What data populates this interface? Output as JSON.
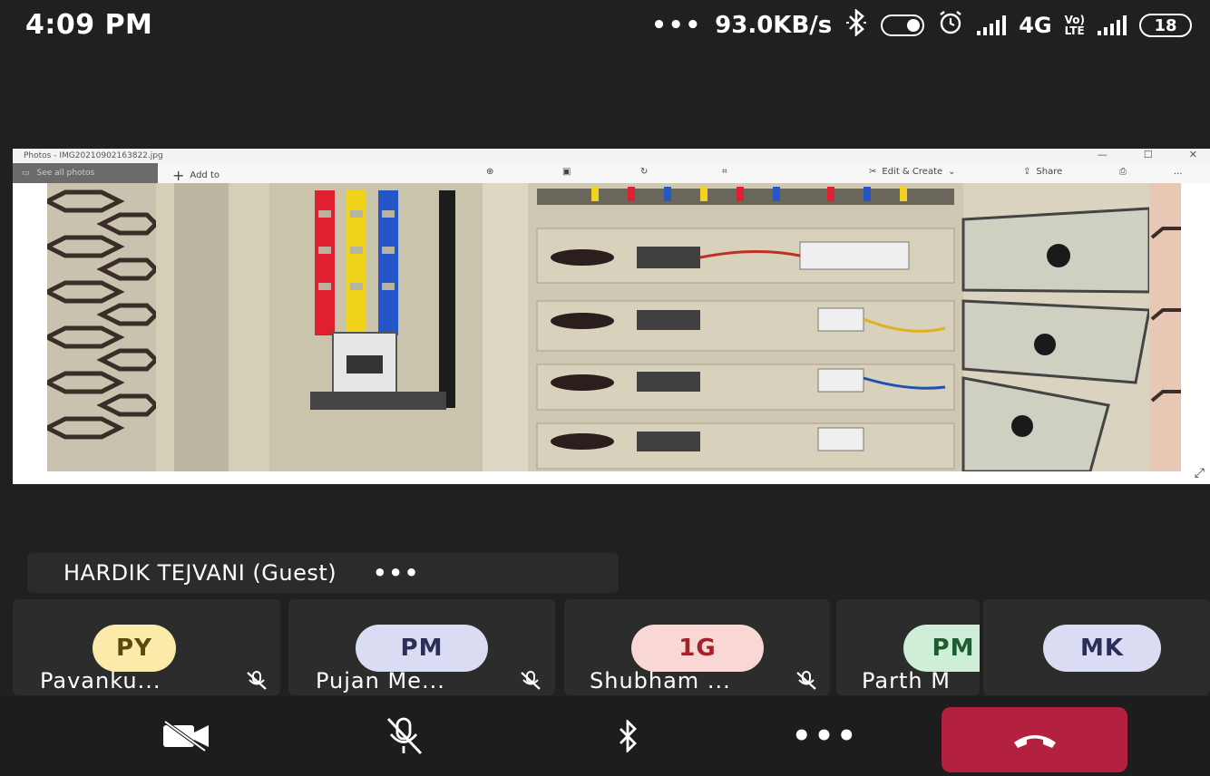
{
  "status_bar": {
    "time": "4:09 PM",
    "dots": "•••",
    "speed": "93.0KB/s",
    "network_label": "4G",
    "volte_top": "Vo)",
    "volte_bottom": "LTE",
    "battery": "18"
  },
  "shared_window": {
    "title": "Photos - IMG20210902163822.jpg",
    "see_all": "See all photos",
    "add_to": "Add to",
    "edit_create": "Edit & Create",
    "share": "Share",
    "more": "..."
  },
  "presenter": {
    "name": "HARDIK TEJVANI (Guest)",
    "more": "•••"
  },
  "participants": [
    {
      "initials": "PY",
      "name": "Pavanku...",
      "avatar_color": "#fbeaa9",
      "text_color": "#5a4a10",
      "muted": true
    },
    {
      "initials": "PM",
      "name": "Pujan Me...",
      "avatar_color": "#d9dcf3",
      "text_color": "#2c2e57",
      "muted": true
    },
    {
      "initials": "1G",
      "name": "Shubham ...",
      "avatar_color": "#f8d7d4",
      "text_color": "#a3222a",
      "muted": true
    },
    {
      "initials": "PM",
      "name": "Parth M",
      "avatar_color": "#cfeed8",
      "text_color": "#1f5c31",
      "muted": false
    },
    {
      "initials": "MK",
      "name": "",
      "avatar_color": "#d9dcf3",
      "text_color": "#2c2e57",
      "muted": false
    }
  ],
  "controls": {
    "hangup_color": "#b3213e",
    "more": "•••"
  }
}
